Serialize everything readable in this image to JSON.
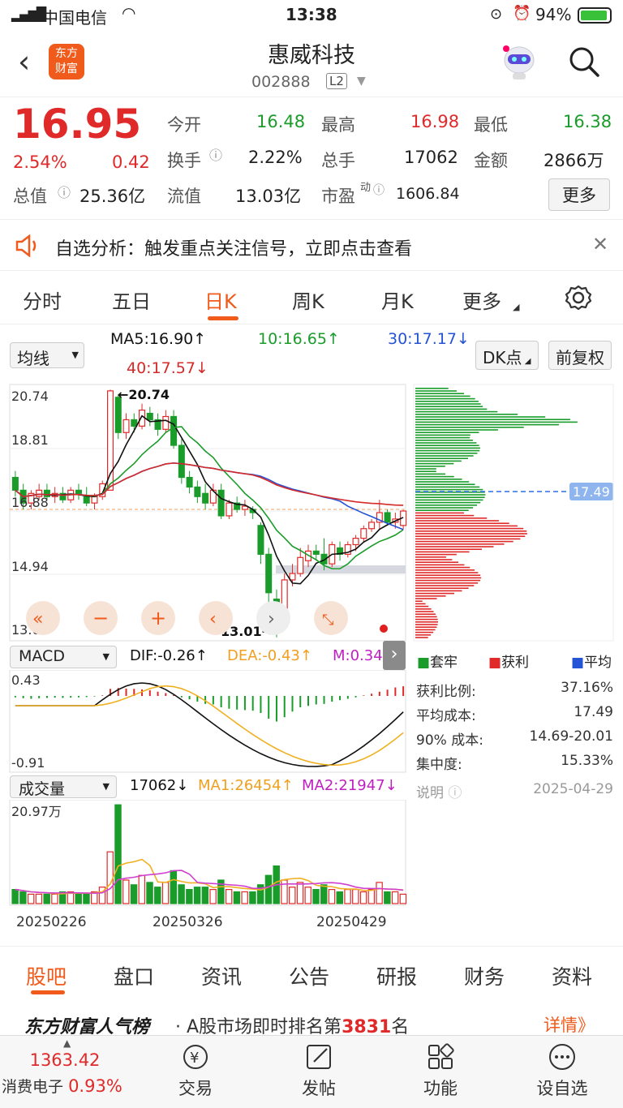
{
  "status_bar": {
    "carrier": "中国电信",
    "time": "13:38",
    "battery": "94%"
  },
  "header": {
    "title": "惠威科技",
    "code": "002888",
    "level": "L2",
    "logo_line1": "东方",
    "logo_line2": "财富"
  },
  "quote": {
    "price": "16.95",
    "change_pct": "2.54%",
    "change": "0.42",
    "open_label": "今开",
    "open": "16.48",
    "high_label": "最高",
    "high": "16.98",
    "low_label": "最低",
    "low": "16.38",
    "turnover_label": "换手",
    "turnover": "2.22%",
    "volume_label": "总手",
    "volume": "17062",
    "amount_label": "金额",
    "amount": "2866万",
    "total_mv_label": "总值",
    "total_mv": "25.36亿",
    "float_mv_label": "流值",
    "float_mv": "13.03亿",
    "pe_label": "市盈",
    "pe_sup": "动",
    "pe": "1606.84",
    "more_button": "更多"
  },
  "notice": {
    "text": "自选分析：触发重点关注信号，立即点击查看"
  },
  "tabs": [
    "分时",
    "五日",
    "日K",
    "周K",
    "月K",
    "更多"
  ],
  "kline": {
    "indicator_select": "均线",
    "ma5": "MA5:16.90↑",
    "ma10": "10:16.65↑",
    "ma30": "30:17.17↓",
    "ma40": "40:17.57↓",
    "dk_button": "DK点",
    "adjust_button": "前复权",
    "y_labels": [
      "20.74",
      "18.81",
      "16.88",
      "14.94",
      "13.01"
    ],
    "high_marker": "20.74",
    "low_marker": "13.01",
    "avg_cost_tag": "17.49"
  },
  "chip_panel": {
    "legend": [
      "套牢",
      "获利",
      "平均"
    ],
    "rows": [
      {
        "label": "获利比例:",
        "value": "37.16%"
      },
      {
        "label": "平均成本:",
        "value": "17.49"
      },
      {
        "label": "90% 成本:",
        "value": "14.69-20.01"
      },
      {
        "label": "集中度:",
        "value": "15.33%"
      }
    ],
    "note_label": "说明",
    "date": "2025-04-29"
  },
  "macd": {
    "select": "MACD",
    "dif": "DIF:-0.26↑",
    "dea": "DEA:-0.43↑",
    "m": "M:0.34",
    "y_top": "0.43",
    "y_bottom": "-0.91"
  },
  "volume": {
    "select": "成交量",
    "value": "17062↓",
    "ma1": "MA1:26454↑",
    "ma2": "MA2:21947↓",
    "y_top": "20.97万",
    "dates": [
      "20250226",
      "20250326",
      "20250429"
    ]
  },
  "bottom_tabs": [
    "股吧",
    "盘口",
    "资讯",
    "公告",
    "研报",
    "财务",
    "资料"
  ],
  "rank": {
    "brand": "东方财富人气榜",
    "text_prefix": "A股市场即时排名第",
    "rank": "3831",
    "text_suffix": "名",
    "detail": "详情》"
  },
  "dock": {
    "index_value": "1363.42",
    "index_name": "消费电子",
    "index_pct": "0.93%",
    "items": [
      "交易",
      "发帖",
      "功能",
      "设自选"
    ]
  },
  "colors": {
    "up": "#e02929",
    "down": "#1a9c2a",
    "accent": "#f05a1a"
  }
}
